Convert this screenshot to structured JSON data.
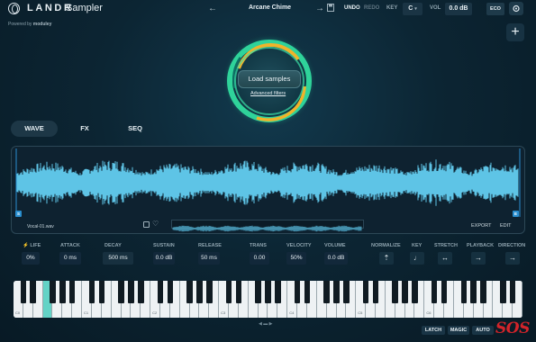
{
  "header": {
    "brand": "LANDR",
    "product": "Sampler",
    "powered_by": "Powered by",
    "powered_brand": "moduley",
    "preset_name": "Arcane Chime",
    "undo": "UNDO",
    "redo": "REDO",
    "key_label": "KEY",
    "key_value": "C",
    "vol_label": "VOL",
    "vol_value": "0.0 dB",
    "eco": "ECO"
  },
  "loader": {
    "load_button": "Load samples",
    "advanced_filters": "Advanced filters",
    "ring_colors": [
      "#2fd39a",
      "#f0b32a",
      "#0d6f63"
    ]
  },
  "tabs": [
    {
      "label": "WAVE",
      "active": true
    },
    {
      "label": "FX",
      "active": false
    },
    {
      "label": "SEQ",
      "active": false
    }
  ],
  "wave": {
    "start_marker": "S",
    "end_marker": "E",
    "filename": "Vocal-01.wav",
    "export": "EXPORT",
    "edit": "EDIT",
    "wave_color": "#5ec4e6"
  },
  "params": [
    {
      "label": "LIFE",
      "value": "0%"
    },
    {
      "label": "ATTACK",
      "value": "0 ms"
    },
    {
      "label": "DECAY",
      "value": "500 ms"
    },
    {
      "label": "SUSTAIN",
      "value": "0.0 dB"
    },
    {
      "label": "RELEASE",
      "value": "50 ms"
    },
    {
      "label": "TRANS",
      "value": "0.00"
    },
    {
      "label": "VELOCITY",
      "value": "50%"
    },
    {
      "label": "VOLUME",
      "value": "0.0 dB"
    }
  ],
  "modes": [
    {
      "label": "NORMALIZE",
      "icon": "normalize-icon"
    },
    {
      "label": "KEY",
      "icon": "key-icon"
    },
    {
      "label": "STRETCH",
      "icon": "stretch-icon"
    },
    {
      "label": "PLAYBACK",
      "icon": "arrow-right-icon"
    },
    {
      "label": "DIRECTION",
      "icon": "arrow-right-icon"
    }
  ],
  "keyboard": {
    "octave_labels": [
      "C0",
      "C1",
      "C2",
      "C3",
      "C4",
      "C5",
      "C6"
    ],
    "highlight_color": "#63d3c6"
  },
  "footer": {
    "latch": "LATCH",
    "magic": "MAGIC",
    "auto": "AUTO",
    "watermark": "SOS"
  }
}
